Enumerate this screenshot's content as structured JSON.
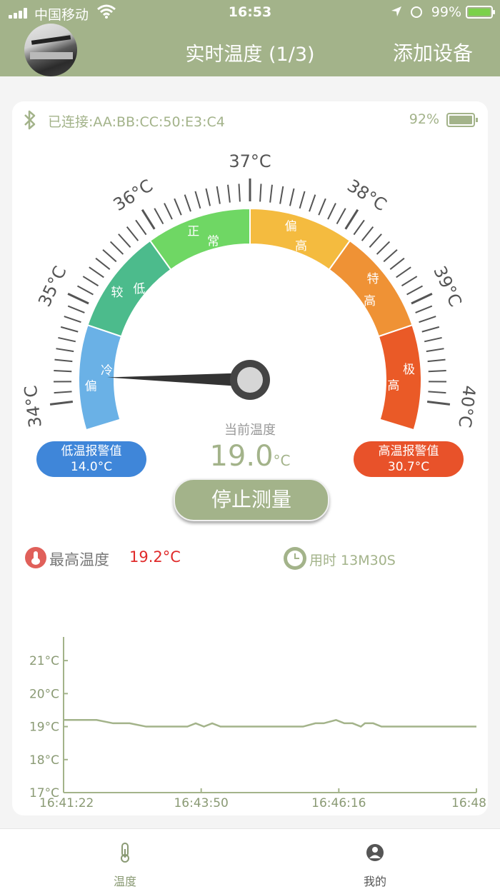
{
  "status_bar": {
    "carrier": "中国移动",
    "time": "16:53",
    "battery": "99%"
  },
  "header": {
    "title": "实时温度 (1/3)",
    "add_device": "添加设备"
  },
  "device": {
    "connection": "已连接:AA:BB:CC:50:E3:C4",
    "battery_pct": "92%"
  },
  "gauge": {
    "ticks": [
      "34°C",
      "35°C",
      "36°C",
      "37°C",
      "38°C",
      "39°C",
      "40°C"
    ],
    "zones": [
      {
        "label": "偏冷",
        "color": "#6ab1e6"
      },
      {
        "label": "较低",
        "color": "#4cbb8c"
      },
      {
        "label": "正常",
        "color": "#6fd764"
      },
      {
        "label": "偏高",
        "color": "#f4bb3f"
      },
      {
        "label": "特高",
        "color": "#ef9235"
      },
      {
        "label": "极高",
        "color": "#ea5a27"
      }
    ],
    "current_label": "当前温度",
    "current_value": "19.0",
    "current_unit": "°C"
  },
  "alarms": {
    "low_label": "低温报警值",
    "low_value": "14.0°C",
    "high_label": "高温报警值",
    "high_value": "30.7°C"
  },
  "stop_button": "停止测量",
  "stats": {
    "max_label": "最高温度",
    "max_value": "19.2°C",
    "used_time": "用时 13M30S"
  },
  "chart_data": {
    "type": "line",
    "y_ticks": [
      "21°C",
      "20°C",
      "19°C",
      "18°C",
      "17°C"
    ],
    "ylim": [
      17,
      21.5
    ],
    "x_ticks": [
      "16:41:22",
      "16:43:50",
      "16:46:16",
      "16:48"
    ],
    "series": [
      {
        "color": "#a3b38a",
        "points": [
          [
            0,
            19.2
          ],
          [
            0.04,
            19.2
          ],
          [
            0.08,
            19.2
          ],
          [
            0.12,
            19.1
          ],
          [
            0.16,
            19.1
          ],
          [
            0.2,
            19.0
          ],
          [
            0.24,
            19.0
          ],
          [
            0.28,
            19.0
          ],
          [
            0.3,
            19.0
          ],
          [
            0.32,
            19.1
          ],
          [
            0.34,
            19.0
          ],
          [
            0.36,
            19.1
          ],
          [
            0.38,
            19.0
          ],
          [
            0.42,
            19.0
          ],
          [
            0.46,
            19.0
          ],
          [
            0.5,
            19.0
          ],
          [
            0.54,
            19.0
          ],
          [
            0.58,
            19.0
          ],
          [
            0.61,
            19.1
          ],
          [
            0.63,
            19.1
          ],
          [
            0.66,
            19.2
          ],
          [
            0.68,
            19.1
          ],
          [
            0.7,
            19.1
          ],
          [
            0.72,
            19.0
          ],
          [
            0.73,
            19.1
          ],
          [
            0.75,
            19.1
          ],
          [
            0.77,
            19.0
          ],
          [
            0.8,
            19.0
          ],
          [
            0.85,
            19.0
          ],
          [
            0.9,
            19.0
          ],
          [
            0.95,
            19.0
          ],
          [
            1,
            19.0
          ]
        ]
      }
    ]
  },
  "tabs": [
    {
      "label": "温度"
    },
    {
      "label": "我的"
    }
  ]
}
